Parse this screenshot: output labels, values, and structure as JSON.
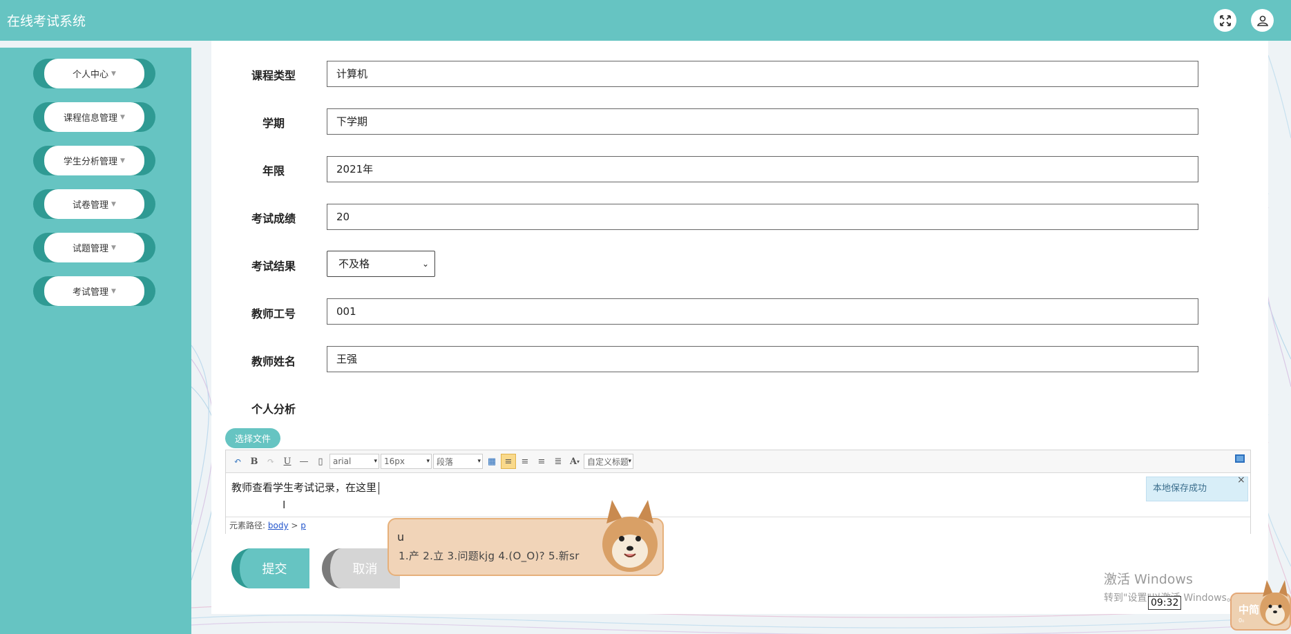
{
  "app": {
    "title": "在线考试系统"
  },
  "sidebar": {
    "items": [
      {
        "label": "个人中心"
      },
      {
        "label": "课程信息管理"
      },
      {
        "label": "学生分析管理"
      },
      {
        "label": "试卷管理"
      },
      {
        "label": "试题管理"
      },
      {
        "label": "考试管理"
      }
    ]
  },
  "form": {
    "fields": [
      {
        "label": "课程类型",
        "value": "计算机"
      },
      {
        "label": "学期",
        "value": "下学期"
      },
      {
        "label": "年限",
        "value": "2021年"
      },
      {
        "label": "考试成绩",
        "value": "20"
      },
      {
        "label": "考试结果",
        "value": "不及格"
      },
      {
        "label": "教师工号",
        "value": "001"
      },
      {
        "label": "教师姓名",
        "value": "王强"
      },
      {
        "label": "个人分析"
      }
    ],
    "choose_file_label": "选择文件",
    "submit_label": "提交",
    "cancel_label": "取消"
  },
  "editor": {
    "font_family": "arial",
    "font_size": "16px",
    "paragraph": "段落",
    "custom_title": "自定义标题",
    "content": "教师查看学生考试记录，在这里",
    "path_prefix": "元素路径:",
    "path_body": "body",
    "path_sep": ">",
    "path_p": "p",
    "toast": "本地保存成功",
    "toast_close": "×"
  },
  "ime": {
    "input": "u",
    "candidates": "1.产  2.立  3.问题kjg  4.(O_O)?  5.新sr",
    "arrow": "◁▷",
    "status_text": "中简",
    "status_sub": "0₀"
  },
  "system": {
    "activate_title": "激活 Windows",
    "activate_sub": "转到\"设置\"以激活 Windows。",
    "clock": "09:32"
  },
  "colors": {
    "primary": "#66c4c2",
    "primary_dark": "#2f9a93",
    "cancel": "#d5d5d5"
  }
}
